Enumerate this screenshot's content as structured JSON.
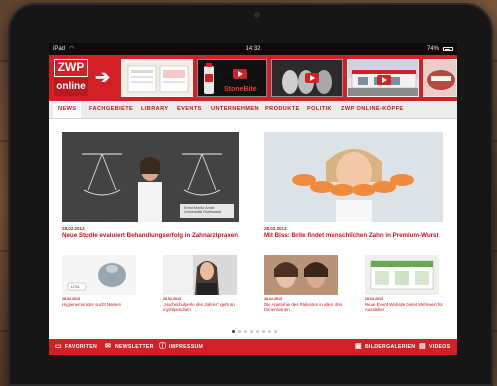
{
  "status_bar": {
    "device": "iPad",
    "time": "14:32",
    "battery": "74%"
  },
  "header": {
    "logo_top": "ZWP",
    "logo_bottom": "online",
    "banner_text": "StoneBite"
  },
  "nav": {
    "items": [
      {
        "label": "NEWS",
        "active": true
      },
      {
        "label": "FACHGEBIETE",
        "active": false
      },
      {
        "label": "LIBRARY",
        "active": false
      },
      {
        "label": "EVENTS",
        "active": false
      },
      {
        "label": "UNTERNEHMEN",
        "active": false
      },
      {
        "label": "PRODUKTE",
        "active": false
      },
      {
        "label": "POLITIK",
        "active": false
      },
      {
        "label": "ZWP ONLINE-KÖPFE",
        "active": false
      }
    ]
  },
  "featured": [
    {
      "date": "28.02.2013",
      "title": "Neue Studie evaluiert Behandlungserfolg in Zahnarztpraxen",
      "image_caption": "Ernst Moritz Arndt Universität Greifswald"
    },
    {
      "date": "28.02.2013",
      "title": "Mit Biss: Brite findet menschlichen Zahn in Premium-Wurst"
    }
  ],
  "articles": [
    {
      "date": "28.02.2013",
      "title": "Hygienemonster sucht Namen",
      "image_text": "LISA"
    },
    {
      "date": "28.02.2013",
      "title": "„Hochschulperle des Jahres\" geht an myStipendium"
    },
    {
      "date": "28.02.2013",
      "title": "Die Anatomie des Patienten in allen drei Dimensionen"
    },
    {
      "date": "28.02.2013",
      "title": "Neue Event-Website bietet Mehrwert für Aussteller"
    }
  ],
  "pagination": {
    "pages": 8,
    "current": 1
  },
  "footer": {
    "favoriten": "FAVORITEN",
    "newsletter": "NEWSLETTER",
    "impressum": "IMPRESSUM",
    "bildergalerien": "BILDERGALERIEN",
    "videos": "VIDEOS"
  },
  "colors": {
    "brand_red": "#d32027",
    "nav_background": "#ececec",
    "link_red": "#c0171f"
  }
}
